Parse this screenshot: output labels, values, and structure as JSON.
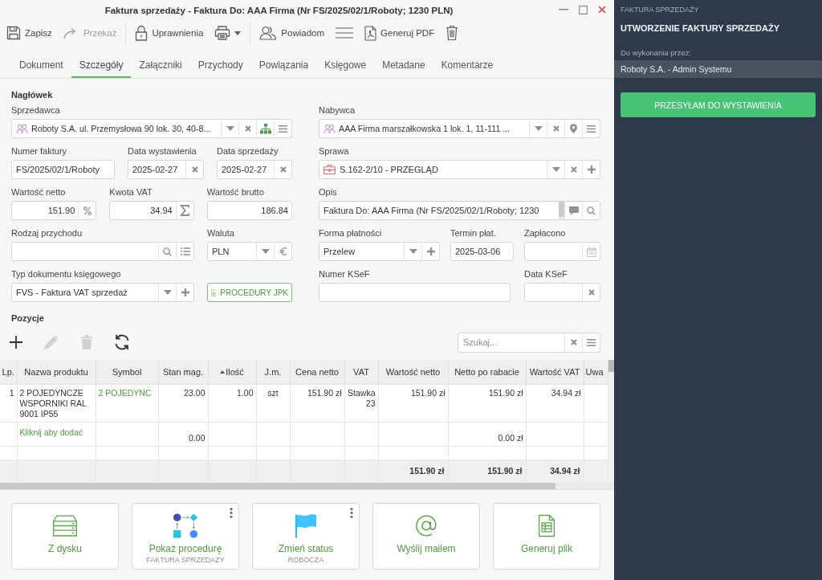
{
  "window": {
    "title": "Faktura sprzedaży - Faktura Do: AAA Firma (Nr FS/2025/02/1/Roboty; 1230 PLN)"
  },
  "toolbar": [
    {
      "kind": "save",
      "label": "Zapisz",
      "disabled": false
    },
    {
      "kind": "forward",
      "label": "Przekaż",
      "disabled": true
    },
    {
      "kind": "separator"
    },
    {
      "kind": "lock",
      "label": "Uprawnienia",
      "disabled": false
    },
    {
      "kind": "print",
      "disabled": false
    },
    {
      "kind": "separator"
    },
    {
      "kind": "notify",
      "label": "Powiadom",
      "disabled": false
    },
    {
      "kind": "menu",
      "disabled": false
    },
    {
      "kind": "pdf",
      "label": "Generuj PDF",
      "disabled": false
    },
    {
      "kind": "trash",
      "disabled": false
    }
  ],
  "tabs": [
    {
      "label": "Dokument",
      "selected": false
    },
    {
      "label": "Szczegóły",
      "selected": true
    },
    {
      "label": "Załączniki",
      "selected": false
    },
    {
      "label": "Przychody",
      "selected": false
    },
    {
      "label": "Powiązania",
      "selected": false
    },
    {
      "label": "Księgowe",
      "selected": false
    },
    {
      "label": "Metadane",
      "selected": false
    },
    {
      "label": "Komentarze",
      "selected": false
    }
  ],
  "form": {
    "title": "Nagłówek",
    "columns": [
      [
        [
          {
            "kind": "contact",
            "label": "Sprzedawca",
            "value": "Roboty S.A. ul. Przemysłowa 90 lok. 30, 40-8...",
            "buttons": [
              {
                "kind": "dropdown"
              },
              {
                "kind": "clear"
              },
              {
                "kind": "hierarchy"
              },
              {
                "kind": "menu"
              }
            ]
          }
        ],
        [
          {
            "kind": "text",
            "label": "Numer faktury",
            "value": "FS/2025/02/1/Roboty"
          },
          {
            "kind": "date",
            "label": "Data wystawienia",
            "value": "2025-02-27",
            "buttons": [
              {
                "kind": "clear"
              }
            ]
          },
          {
            "kind": "date",
            "label": "Data sprzedaży",
            "value": "2025-02-27",
            "buttons": [
              {
                "kind": "clear"
              }
            ]
          }
        ],
        [
          {
            "kind": "amount",
            "label": "Wartość netto",
            "value": "151.90",
            "buttons": [
              {
                "kind": "percent"
              }
            ]
          },
          {
            "kind": "amount",
            "label": "Kwota VAT",
            "value": "34.94",
            "buttons": [
              {
                "kind": "sigma"
              }
            ]
          },
          {
            "kind": "amount",
            "label": "Wartość brutto",
            "value": "186.84"
          }
        ],
        [
          {
            "kind": "lookup",
            "label": "Rodzaj przychodu",
            "buttons": [
              {
                "kind": "search"
              },
              {
                "kind": "list"
              }
            ]
          },
          {
            "kind": "select",
            "label": "Waluta",
            "value": "PLN",
            "buttons": [
              {
                "kind": "dropdown"
              },
              {
                "kind": "euro"
              }
            ]
          }
        ],
        [
          {
            "kind": "select",
            "label": "Typ dokumentu księgowego",
            "value": "FVS - Faktura VAT sprzedaż",
            "buttons": [
              {
                "kind": "dropdown"
              },
              {
                "kind": "plus"
              }
            ]
          },
          {
            "kind": "button",
            "text": "PROCEDURY JPK"
          }
        ]
      ],
      [
        [
          {
            "kind": "contact",
            "label": "Nabywca",
            "value": "AAA Firma marszałkowska 1 lok. 1, 11-111 ...",
            "buttons": [
              {
                "kind": "dropdown"
              },
              {
                "kind": "clear"
              },
              {
                "kind": "pin"
              },
              {
                "kind": "menu"
              }
            ]
          }
        ],
        [
          {
            "kind": "case",
            "label": "Sprawa",
            "value": "S.162-2/10 - PRZEGLĄD",
            "buttons": [
              {
                "kind": "dropdown"
              },
              {
                "kind": "clear"
              },
              {
                "kind": "plus"
              }
            ]
          }
        ],
        [
          {
            "kind": "memo",
            "label": "Opis",
            "value": "Faktura Do: AAA Firma (Nr FS/2025/02/1/Roboty; 1230",
            "buttons": [
              {
                "kind": "comment"
              },
              {
                "kind": "search"
              }
            ]
          }
        ],
        [
          {
            "kind": "select",
            "label": "Forma płatności",
            "value": "Przelew",
            "buttons": [
              {
                "kind": "dropdown"
              },
              {
                "kind": "plus"
              }
            ]
          },
          {
            "kind": "date",
            "label": "Termin płat.",
            "value": "2025-03-06"
          },
          {
            "kind": "date",
            "label": "Zapłacono",
            "buttons": [
              {
                "kind": "calendar"
              }
            ]
          }
        ],
        [
          {
            "kind": "text",
            "label": "Numer KSeF"
          },
          {
            "kind": "date",
            "label": "Data KSeF",
            "buttons": [
              {
                "kind": "clear"
              }
            ]
          }
        ]
      ]
    ]
  },
  "positions": {
    "title": "Pozycje",
    "tools": [
      {
        "kind": "add",
        "disabled": false
      },
      {
        "kind": "edit",
        "disabled": true
      },
      {
        "kind": "delete",
        "disabled": true
      },
      {
        "kind": "refresh",
        "disabled": false
      }
    ],
    "search": {
      "placeholder": "Szukaj...",
      "buttons": [
        {
          "kind": "clear"
        },
        {
          "kind": "menu"
        }
      ]
    },
    "table": {
      "columns": [
        {
          "label": "Lp.",
          "sorted": false
        },
        {
          "label": "Nazwa produktu",
          "sorted": false
        },
        {
          "label": "Symbol",
          "sorted": false
        },
        {
          "label": "Stan mag.",
          "sorted": false
        },
        {
          "label": "Ilość",
          "sorted": true
        },
        {
          "label": "J.m.",
          "sorted": false
        },
        {
          "label": "Cena netto",
          "sorted": false
        },
        {
          "label": "VAT",
          "sorted": false
        },
        {
          "label": "Wartość netto",
          "sorted": false
        },
        {
          "label": "Netto po rabacie",
          "sorted": false
        },
        {
          "label": "Wartość VAT",
          "sorted": false
        },
        {
          "label": "Uwa",
          "sorted": false
        }
      ],
      "rows": [
        {
          "kind": "item",
          "cells": {
            "lp": "1",
            "product_name": "2 POJEDYNCZE WSPORNIKI RAL 9001 IP55",
            "symbol": "2 POJEDYNC",
            "stock": "23.00",
            "quantity": "1.00",
            "unit": "szt",
            "net_price": "151.90 zł",
            "vat": "Stawka 23",
            "net_value": "151.90 zł",
            "net_after_discount": "151.90 zł",
            "vat_value": "34.94 zł"
          }
        },
        {
          "kind": "add",
          "cells": {
            "product_name": "Kliknij aby dodać",
            "stock": "0.00",
            "net_after_discount": "0.00 zł"
          }
        },
        {
          "kind": "blank"
        }
      ],
      "totals": {
        "net_value": "151.90 zł",
        "net_after_discount": "151.90 zł",
        "vat_value": "34.94 zł"
      }
    }
  },
  "actions": [
    {
      "kind": "disk",
      "label": "Z dysku",
      "more": false
    },
    {
      "kind": "procedure",
      "label": "Pokaż procedurę",
      "sublabel": "FAKTURA SPRZEDAZY",
      "more": true
    },
    {
      "kind": "flag",
      "label": "Zmień status",
      "sublabel": "ROBOCZA",
      "more": true
    },
    {
      "kind": "email",
      "label": "Wyślij mailem",
      "more": false
    },
    {
      "kind": "file",
      "label": "Generuj plik",
      "more": false
    }
  ],
  "task_panel": {
    "process": "FAKTURA SPRZEDAŻY",
    "task": "UTWORZENIE FAKTURY SPRZEDAŻY",
    "assignee_label": "Do wykonania przez:",
    "assignee": "Roboty S.A. - Admin Systemu",
    "action": "PRZESYŁAM DO WYSTAWIENIA"
  }
}
